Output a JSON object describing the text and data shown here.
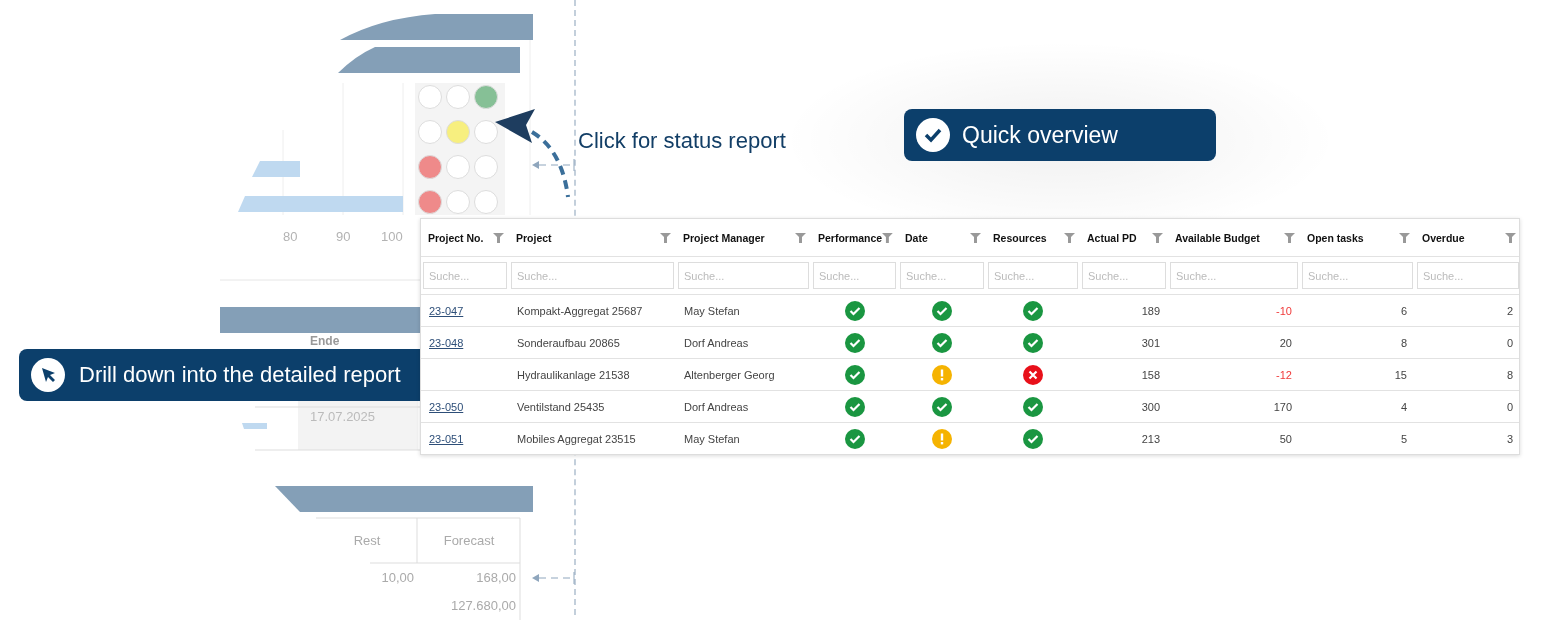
{
  "status_lights": [
    [
      {
        "color": "#ffffff"
      },
      {
        "color": "#ffffff"
      },
      {
        "color": "#86c096"
      }
    ],
    [
      {
        "color": "#ffffff"
      },
      {
        "color": "#f7ef7f"
      },
      {
        "color": "#ffffff"
      }
    ],
    [
      {
        "color": "#ef8a8a"
      },
      {
        "color": "#ffffff"
      },
      {
        "color": "#ffffff"
      }
    ],
    [
      {
        "color": "#ef8a8a"
      },
      {
        "color": "#ffffff"
      },
      {
        "color": "#ffffff"
      }
    ]
  ],
  "axis_labels": [
    "80",
    "90",
    "100"
  ],
  "schedule_fragment": {
    "column_heading": "Ende",
    "date": "17.07.2025"
  },
  "cost_fragment": {
    "columns": [
      "Rest",
      "Forecast"
    ],
    "rows": [
      {
        "rest": "10,00",
        "forecast": "168,00"
      },
      {
        "forecast": "127.680,00"
      }
    ]
  },
  "hint": "Click for status report",
  "callouts": [
    {
      "kind": "check",
      "text": "Quick overview"
    },
    {
      "kind": "pointer",
      "text": "Drill down into the detailed report"
    }
  ],
  "table": {
    "columns": [
      {
        "label": "Project No.",
        "placeholder": "Suche..."
      },
      {
        "label": "Project",
        "placeholder": "Suche..."
      },
      {
        "label": "Project Manager",
        "placeholder": "Suche..."
      },
      {
        "label": "Performance",
        "placeholder": "Suche..."
      },
      {
        "label": "Date",
        "placeholder": "Suche..."
      },
      {
        "label": "Resources",
        "placeholder": "Suche..."
      },
      {
        "label": "Actual PD",
        "placeholder": "Suche..."
      },
      {
        "label": "Available Budget",
        "placeholder": "Suche..."
      },
      {
        "label": "Open tasks",
        "placeholder": "Suche..."
      },
      {
        "label": "Overdue",
        "placeholder": "Suche..."
      }
    ],
    "rows": [
      {
        "project_no": "23-047",
        "project": "Kompakt-Aggregat 25687",
        "manager": "May Stefan",
        "status": [
          {
            "kind": "ok"
          },
          {
            "kind": "ok"
          },
          {
            "kind": "ok"
          }
        ],
        "actual_pd": "189",
        "budget": "-10",
        "budget_negative": true,
        "open_tasks": "6",
        "overdue": "2"
      },
      {
        "project_no": "23-048",
        "project": "Sonderaufbau 20865",
        "manager": "Dorf Andreas",
        "status": [
          {
            "kind": "ok"
          },
          {
            "kind": "ok"
          },
          {
            "kind": "ok"
          }
        ],
        "actual_pd": "301",
        "budget": "20",
        "budget_negative": false,
        "open_tasks": "8",
        "overdue": "0"
      },
      {
        "project": "Hydraulikanlage 21538",
        "manager": "Altenberger Georg",
        "status": [
          {
            "kind": "ok"
          },
          {
            "kind": "warn"
          },
          {
            "kind": "error"
          }
        ],
        "actual_pd": "158",
        "budget": "-12",
        "budget_negative": true,
        "open_tasks": "15",
        "overdue": "8"
      },
      {
        "project_no": "23-050",
        "project": "Ventilstand 25435",
        "manager": "Dorf Andreas",
        "status": [
          {
            "kind": "ok"
          },
          {
            "kind": "ok"
          },
          {
            "kind": "ok"
          }
        ],
        "actual_pd": "300",
        "budget": "170",
        "budget_negative": false,
        "open_tasks": "4",
        "overdue": "0"
      },
      {
        "project_no": "23-051",
        "project": "Mobiles Aggregat 23515",
        "manager": "May Stefan",
        "status": [
          {
            "kind": "ok"
          },
          {
            "kind": "warn"
          },
          {
            "kind": "ok"
          }
        ],
        "actual_pd": "213",
        "budget": "50",
        "budget_negative": false,
        "open_tasks": "5",
        "overdue": "3"
      }
    ]
  }
}
